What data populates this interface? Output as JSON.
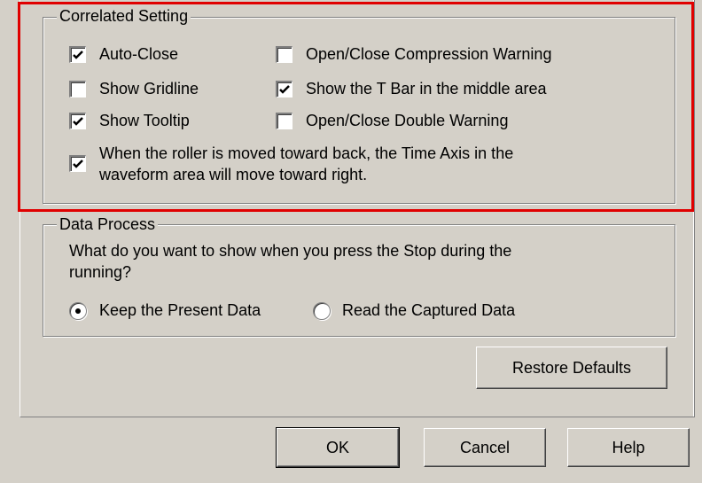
{
  "correlated": {
    "legend": "Correlated Setting",
    "options": [
      {
        "label": "Auto-Close",
        "checked": true
      },
      {
        "label": "Show Gridline",
        "checked": false
      },
      {
        "label": "Show Tooltip",
        "checked": true
      },
      {
        "label": "Open/Close Compression Warning",
        "checked": false
      },
      {
        "label": "Show the T Bar in the middle area",
        "checked": true
      },
      {
        "label": "Open/Close Double Warning",
        "checked": false
      }
    ],
    "roller": {
      "checked": true,
      "line1": "When the roller is moved toward back, the Time Axis in the",
      "line2": "waveform area will move toward right."
    }
  },
  "data_process": {
    "legend": "Data Process",
    "question_line1": "What do you want to show when you press the Stop during the",
    "question_line2": "running?",
    "options": [
      {
        "label": "Keep the Present Data",
        "selected": true
      },
      {
        "label": "Read the Captured Data",
        "selected": false
      }
    ]
  },
  "buttons": {
    "restore_defaults": "Restore Defaults",
    "ok": "OK",
    "cancel": "Cancel",
    "help": "Help"
  },
  "colors": {
    "highlight": "#e00000",
    "face": "#d4d0c8"
  }
}
